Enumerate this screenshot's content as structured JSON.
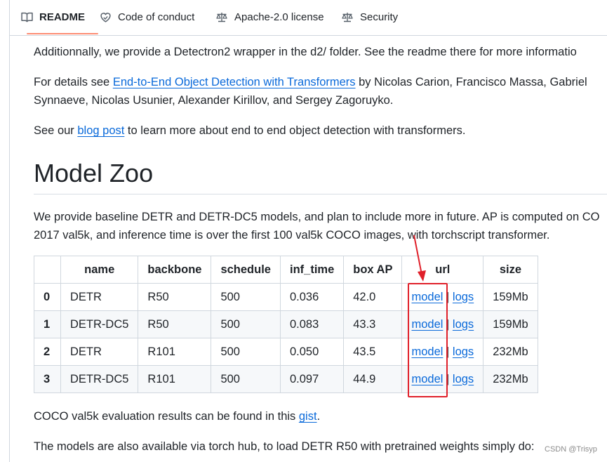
{
  "tabs": [
    {
      "label": "README",
      "icon": "book-icon",
      "active": true
    },
    {
      "label": "Code of conduct",
      "icon": "heart-icon",
      "active": false
    },
    {
      "label": "Apache-2.0 license",
      "icon": "law-icon",
      "active": false
    },
    {
      "label": "Security",
      "icon": "law-icon",
      "active": false
    }
  ],
  "content": {
    "p1": "Additionnally, we provide a Detectron2 wrapper in the d2/ folder. See the readme there for more informatio",
    "p2_prefix": "For details see ",
    "p2_link": "End-to-End Object Detection with Transformers",
    "p2_line1_suffix": " by Nicolas Carion, Francisco Massa, Gabriel",
    "p2_line2": "Synnaeve, Nicolas Usunier, Alexander Kirillov, and Sergey Zagoruyko.",
    "p3_prefix": "See our ",
    "p3_link": "blog post",
    "p3_suffix": " to learn more about end to end object detection with transformers.",
    "heading": "Model Zoo",
    "p4_line1": "We provide baseline DETR and DETR-DC5 models, and plan to include more in future. AP is computed on CO",
    "p4_line2": "2017 val5k, and inference time is over the first 100 val5k COCO images, with torchscript transformer.",
    "p5_prefix": "COCO val5k evaluation results can be found in this ",
    "p5_link": "gist",
    "p5_suffix": ".",
    "p6": "The models are also available via torch hub, to load DETR R50 with pretrained weights simply do:"
  },
  "table": {
    "headers": [
      "",
      "name",
      "backbone",
      "schedule",
      "inf_time",
      "box AP",
      "url",
      "size"
    ],
    "rows": [
      {
        "idx": "0",
        "name": "DETR",
        "backbone": "R50",
        "schedule": "500",
        "inf_time": "0.036",
        "box_ap": "42.0",
        "url_model": "model",
        "url_sep": " | ",
        "url_logs": "logs",
        "size": "159Mb"
      },
      {
        "idx": "1",
        "name": "DETR-DC5",
        "backbone": "R50",
        "schedule": "500",
        "inf_time": "0.083",
        "box_ap": "43.3",
        "url_model": "model",
        "url_sep": " | ",
        "url_logs": "logs",
        "size": "159Mb"
      },
      {
        "idx": "2",
        "name": "DETR",
        "backbone": "R101",
        "schedule": "500",
        "inf_time": "0.050",
        "box_ap": "43.5",
        "url_model": "model",
        "url_sep": " | ",
        "url_logs": "logs",
        "size": "232Mb"
      },
      {
        "idx": "3",
        "name": "DETR-DC5",
        "backbone": "R101",
        "schedule": "500",
        "inf_time": "0.097",
        "box_ap": "44.9",
        "url_model": "model",
        "url_sep": " | ",
        "url_logs": "logs",
        "size": "232Mb"
      }
    ]
  },
  "watermark": "CSDN @Trisyp",
  "colors": {
    "link": "#0969da",
    "active_tab_underline": "#fd8c73",
    "annotation": "#e0202a"
  }
}
